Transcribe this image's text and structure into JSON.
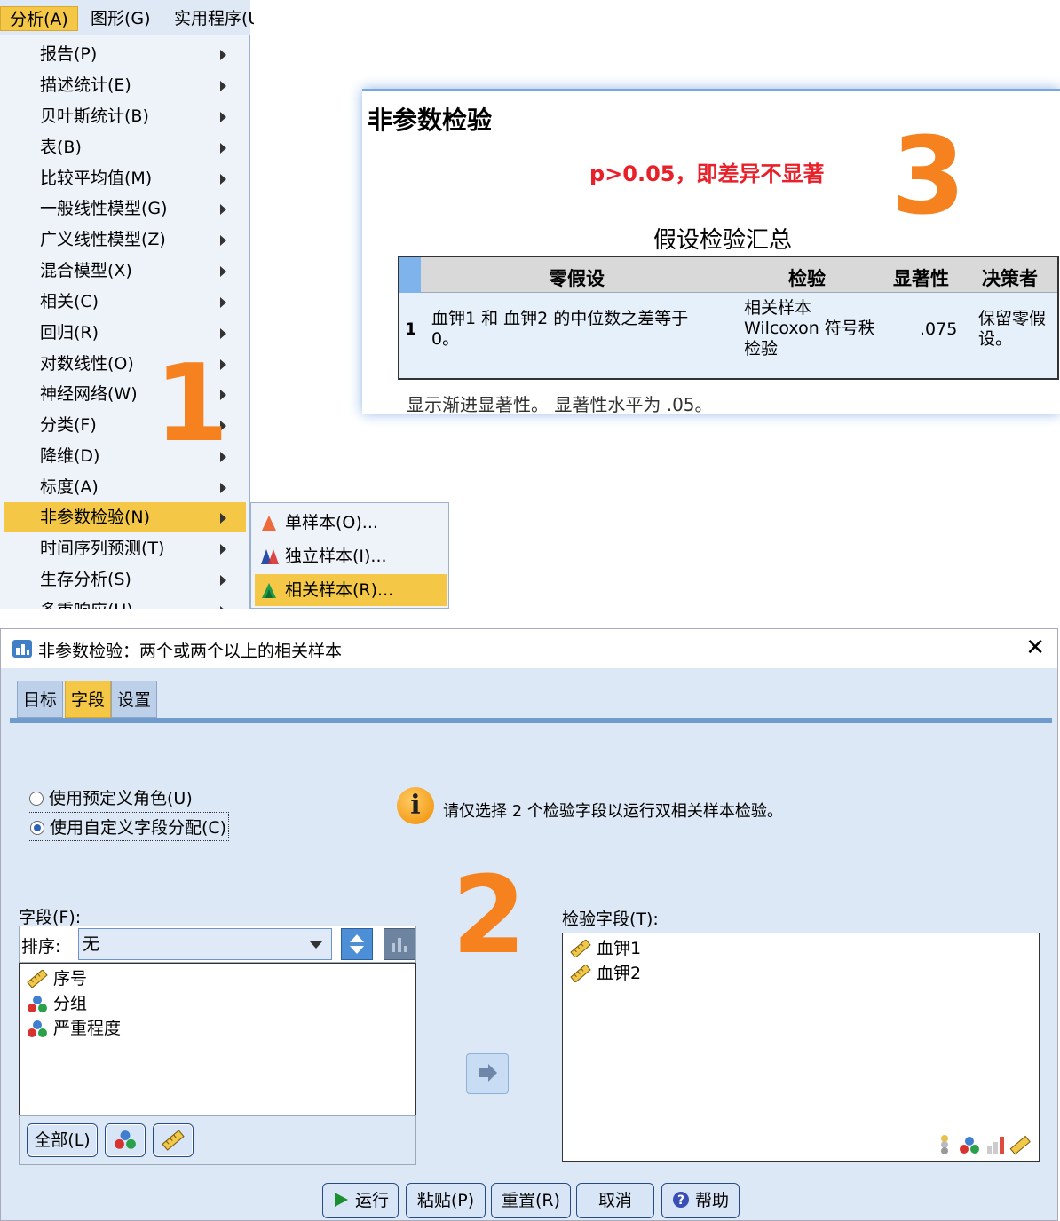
{
  "menubar": {
    "items": [
      {
        "label": "分析(A)"
      },
      {
        "label": "图形(G)"
      },
      {
        "label": "实用程序(U"
      }
    ]
  },
  "analyze_menu": {
    "items": [
      {
        "label": "报告(P)"
      },
      {
        "label": "描述统计(E)"
      },
      {
        "label": "贝叶斯统计(B)"
      },
      {
        "label": "表(B)"
      },
      {
        "label": "比较平均值(M)"
      },
      {
        "label": "一般线性模型(G)"
      },
      {
        "label": "广义线性模型(Z)"
      },
      {
        "label": "混合模型(X)"
      },
      {
        "label": "相关(C)"
      },
      {
        "label": "回归(R)"
      },
      {
        "label": "对数线性(O)"
      },
      {
        "label": "神经网络(W)"
      },
      {
        "label": "分类(F)"
      },
      {
        "label": "降维(D)"
      },
      {
        "label": "标度(A)"
      },
      {
        "label": "非参数检验(N)"
      },
      {
        "label": "时间序列预测(T)"
      },
      {
        "label": "生存分析(S)"
      },
      {
        "label": "多重响应(U)"
      }
    ],
    "active_index": 15
  },
  "nonparam_submenu": {
    "items": [
      {
        "label": "单样本(O)..."
      },
      {
        "label": "独立样本(I)..."
      },
      {
        "label": "相关样本(R)..."
      }
    ],
    "active_index": 2
  },
  "step_numbers": {
    "one": "1",
    "two": "2",
    "three": "3"
  },
  "colors": {
    "accent_orange": "#f5811f",
    "highlight": "#f4c846",
    "note_red": "#e8202a"
  },
  "result": {
    "title": "非参数检验",
    "note": "p>0.05，即差异不显著",
    "table_title": "假设检验汇总",
    "headers": {
      "null_hypothesis": "零假设",
      "test": "检验",
      "sig": "显著性",
      "decision": "决策者"
    },
    "rows": [
      {
        "index": "1",
        "null_hypothesis": "血钾1 和 血钾2 的中位数之差等于 0。",
        "test": "相关样本 Wilcoxon 符号秩检验",
        "sig": ".075",
        "decision": "保留零假设。"
      }
    ],
    "footer": "显示渐进显著性。 显著性水平为 .05。"
  },
  "dialog": {
    "title": "非参数检验：两个或两个以上的相关样本",
    "close_icon": "close-icon",
    "tabs": [
      {
        "label": "目标"
      },
      {
        "label": "字段"
      },
      {
        "label": "设置"
      }
    ],
    "active_tab": 1,
    "radios": [
      {
        "label": "使用预定义角色(U)",
        "selected": false
      },
      {
        "label": "使用自定义字段分配(C)",
        "selected": true
      }
    ],
    "info_text": "请仅选择 2 个检验字段以运行双相关样本检验。",
    "fields_label": "字段(F):",
    "sort_label": "排序:",
    "sort_value": "无",
    "fields": [
      {
        "label": "序号",
        "icon": "ruler-icon"
      },
      {
        "label": "分组",
        "icon": "nominal-icon"
      },
      {
        "label": "严重程度",
        "icon": "nominal-icon"
      }
    ],
    "all_button": "全部(L)",
    "test_fields_label": "检验字段(T):",
    "test_fields": [
      {
        "label": "血钾1",
        "icon": "ruler-icon"
      },
      {
        "label": "血钾2",
        "icon": "ruler-icon"
      }
    ],
    "buttons": {
      "run": "运行",
      "paste": "粘贴(P)",
      "reset": "重置(R)",
      "cancel": "取消",
      "help": "帮助"
    }
  }
}
